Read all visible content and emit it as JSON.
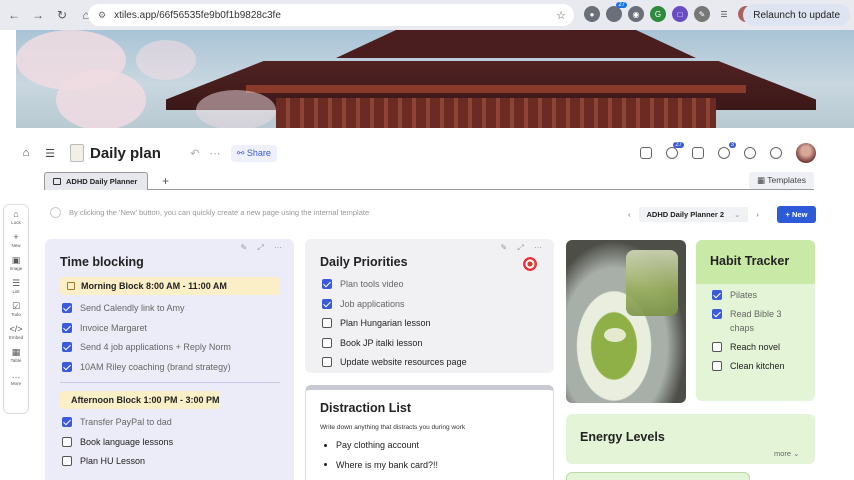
{
  "browser": {
    "url": "xtiles.app/66f56535fe9b0f1b9828c3fe",
    "relaunch_label": "Relaunch to update",
    "ext_badge_1": "27",
    "ext_badge_2": ""
  },
  "page": {
    "title": "Daily plan",
    "share_label": "Share",
    "notif_count_a": "27",
    "notif_count_b": "3"
  },
  "tabs": {
    "active_label": "ADHD Daily Planner",
    "add_label": "+",
    "templates_label": "Templates"
  },
  "rail": {
    "items": [
      {
        "icon": "⌂",
        "label": "Lock"
      },
      {
        "icon": "+",
        "label": "New"
      },
      {
        "icon": "▣",
        "label": "Image"
      },
      {
        "icon": "☰",
        "label": "List"
      },
      {
        "icon": "☑",
        "label": "Todo"
      },
      {
        "icon": "</>",
        "label": "Embed"
      },
      {
        "icon": "▦",
        "label": "Table"
      },
      {
        "icon": "…",
        "label": "More"
      }
    ]
  },
  "hint": {
    "text": "By clicking the 'New' button, you can quickly create a new page using the internal template",
    "pager_name": "ADHD Daily Planner 2",
    "new_label": "New"
  },
  "time_blocking": {
    "title": "Time blocking",
    "morning_label": "Morning Block 8:00 AM - 11:00 AM",
    "morning_items": [
      {
        "text": "Send Calendly link to Amy",
        "checked": true
      },
      {
        "text": "Invoice Margaret",
        "checked": true
      },
      {
        "text": "Send 4 job applications + Reply Norm",
        "checked": true
      },
      {
        "text": "10AM Riley coaching (brand strategy)",
        "checked": true
      }
    ],
    "afternoon_label": "Afternoon Block 1:00 PM - 3:00 PM",
    "afternoon_items": [
      {
        "text": "Transfer PayPal to dad",
        "checked": true
      },
      {
        "text": "Book language lessons",
        "checked": false
      },
      {
        "text": "Plan HU Lesson",
        "checked": false
      }
    ]
  },
  "priorities": {
    "title": "Daily Priorities",
    "items": [
      {
        "text": "Plan tools video",
        "checked": true
      },
      {
        "text": "Job applications",
        "checked": true
      },
      {
        "text": "Plan Hungarian lesson",
        "checked": false
      },
      {
        "text": "Book JP italki lesson",
        "checked": false
      },
      {
        "text": "Update website resources page",
        "checked": false
      }
    ]
  },
  "distraction": {
    "title": "Distraction List",
    "subtitle": "Write down anything that distracts you during work",
    "items": [
      "Pay clothing account",
      "Where is my bank card?!!"
    ]
  },
  "habit": {
    "title": "Habit Tracker",
    "items": [
      {
        "text": "Pilates",
        "checked": true
      },
      {
        "text": "Read Bible 3 chaps",
        "checked": true
      },
      {
        "text": "Reach novel",
        "checked": false
      },
      {
        "text": "Clean kitchen",
        "checked": false
      }
    ]
  },
  "energy": {
    "title": "Energy Levels",
    "more_label": "more"
  },
  "colors": {
    "accent": "#3b5bdb",
    "lavender_card": "#ecebf8",
    "grey_card": "#f1f1f3",
    "green_card": "#e4f4d6",
    "green_header": "#c9eaa7",
    "yellow_block": "#fbefc8"
  }
}
